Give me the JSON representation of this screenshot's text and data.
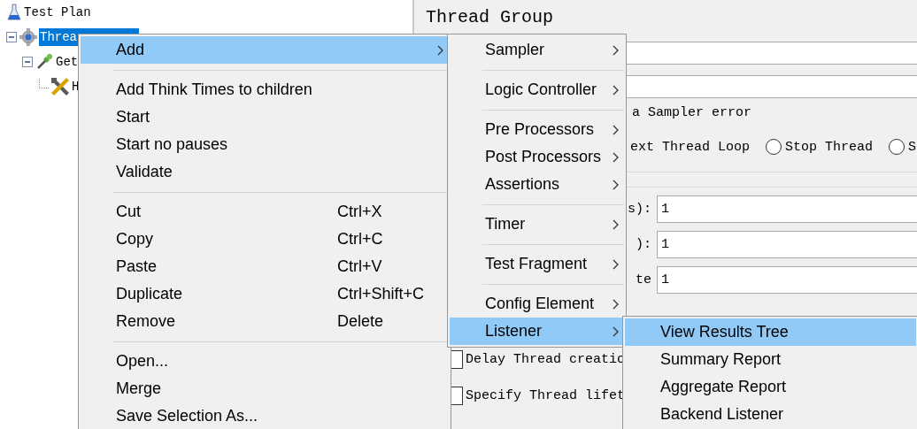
{
  "tree": [
    {
      "label": "Test Plan",
      "kind": "plan",
      "selected": false,
      "children": [
        {
          "label": "Threa",
          "kind": "thread-group",
          "selected": true,
          "expanded": true,
          "children": [
            {
              "label": "Get",
              "kind": "sampler",
              "selected": false,
              "expanded": true,
              "children": [
                {
                  "label": "H",
                  "kind": "config",
                  "selected": false
                }
              ]
            }
          ]
        }
      ]
    }
  ],
  "editor": {
    "title": "Thread Group",
    "error_label": "a Sampler error",
    "error_actions": [
      {
        "label": "ext Thread Loop"
      },
      {
        "label": "Stop Thread",
        "selected": false
      },
      {
        "label": "S",
        "selected": false
      }
    ],
    "thread_fields": [
      {
        "label": "s):",
        "value": "1"
      },
      {
        "label": "):",
        "value": "1"
      },
      {
        "label": "te",
        "value": "1"
      }
    ],
    "checkboxes": [
      {
        "label": "Delay Thread creatio",
        "checked": false
      },
      {
        "label": "Specify Thread lifet",
        "checked": false
      }
    ]
  },
  "context_menu": {
    "items": [
      {
        "label": "Add",
        "has_submenu": true,
        "selected": true
      },
      {
        "label": "Add Think Times to children",
        "separator_before": true,
        "selected": false
      },
      {
        "label": "Start",
        "selected": false
      },
      {
        "label": "Start no pauses",
        "selected": false
      },
      {
        "label": "Validate",
        "selected": false
      },
      {
        "label": "Cut",
        "shortcut": "Ctrl+X",
        "separator_before": true,
        "selected": false
      },
      {
        "label": "Copy",
        "shortcut": "Ctrl+C",
        "selected": false
      },
      {
        "label": "Paste",
        "shortcut": "Ctrl+V",
        "selected": false
      },
      {
        "label": "Duplicate",
        "shortcut": "Ctrl+Shift+C",
        "selected": false
      },
      {
        "label": "Remove",
        "shortcut": "Delete",
        "selected": false
      },
      {
        "label": "Open...",
        "separator_before": true,
        "selected": false
      },
      {
        "label": "Merge",
        "selected": false
      },
      {
        "label": "Save Selection As...",
        "selected": false
      }
    ]
  },
  "add_submenu": {
    "items": [
      {
        "label": "Sampler",
        "has_submenu": true,
        "selected": false
      },
      {
        "label": "Logic Controller",
        "has_submenu": true,
        "separator_before": true,
        "selected": false
      },
      {
        "label": "Pre Processors",
        "has_submenu": true,
        "separator_before": true,
        "selected": false
      },
      {
        "label": "Post Processors",
        "has_submenu": true,
        "selected": false
      },
      {
        "label": "Assertions",
        "has_submenu": true,
        "selected": false
      },
      {
        "label": "Timer",
        "has_submenu": true,
        "separator_before": true,
        "selected": false
      },
      {
        "label": "Test Fragment",
        "has_submenu": true,
        "separator_before": true,
        "selected": false
      },
      {
        "label": "Config Element",
        "has_submenu": true,
        "separator_before": true,
        "selected": false
      },
      {
        "label": "Listener",
        "has_submenu": true,
        "selected": true
      }
    ]
  },
  "listener_submenu": {
    "items": [
      {
        "label": "View Results Tree",
        "selected": true
      },
      {
        "label": "Summary Report",
        "selected": false
      },
      {
        "label": "Aggregate Report",
        "selected": false
      },
      {
        "label": "Backend Listener",
        "selected": false
      }
    ]
  }
}
